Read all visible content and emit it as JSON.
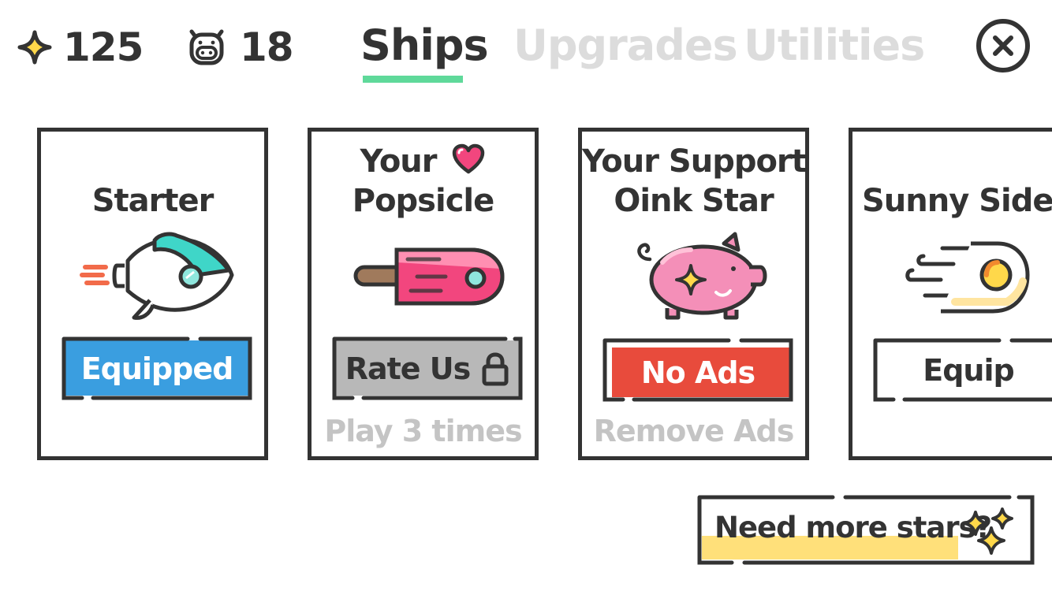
{
  "header": {
    "stars_count": "125",
    "pigs_count": "18",
    "tabs": [
      {
        "label": "Ships",
        "active": true
      },
      {
        "label": "Upgrades",
        "active": false
      },
      {
        "label": "Utilities",
        "active": false
      }
    ]
  },
  "cards": [
    {
      "title_line1": "Starter",
      "title_line2": "",
      "button_label": "Equipped",
      "button_color": "#3a9ee0",
      "subtext": "",
      "art": "rocket-ship"
    },
    {
      "title_line1": "Your",
      "title_line2": "Popsicle",
      "button_label": "Rate Us",
      "button_color": "#b8b8b8",
      "subtext": "Play 3 times",
      "art": "popsicle-ship"
    },
    {
      "title_line1": "Your Support",
      "title_line2": "Oink Star",
      "button_label": "No Ads",
      "button_color": "#e84b3c",
      "subtext": "Remove Ads",
      "art": "piggy-bank-ship"
    },
    {
      "title_line1": "Sunny Side U",
      "title_line2": "",
      "button_label": "Equip",
      "button_color": "#ffffff",
      "subtext": "",
      "art": "fried-egg-ship"
    }
  ],
  "footer": {
    "more_stars_label": "Need more stars?"
  },
  "colors": {
    "outline": "#333333",
    "tab_underline": "#5fd99a",
    "star_fill": "#ffd84a",
    "inactive_tab": "#dcdcdc",
    "highlight_yellow": "#ffe07a"
  }
}
